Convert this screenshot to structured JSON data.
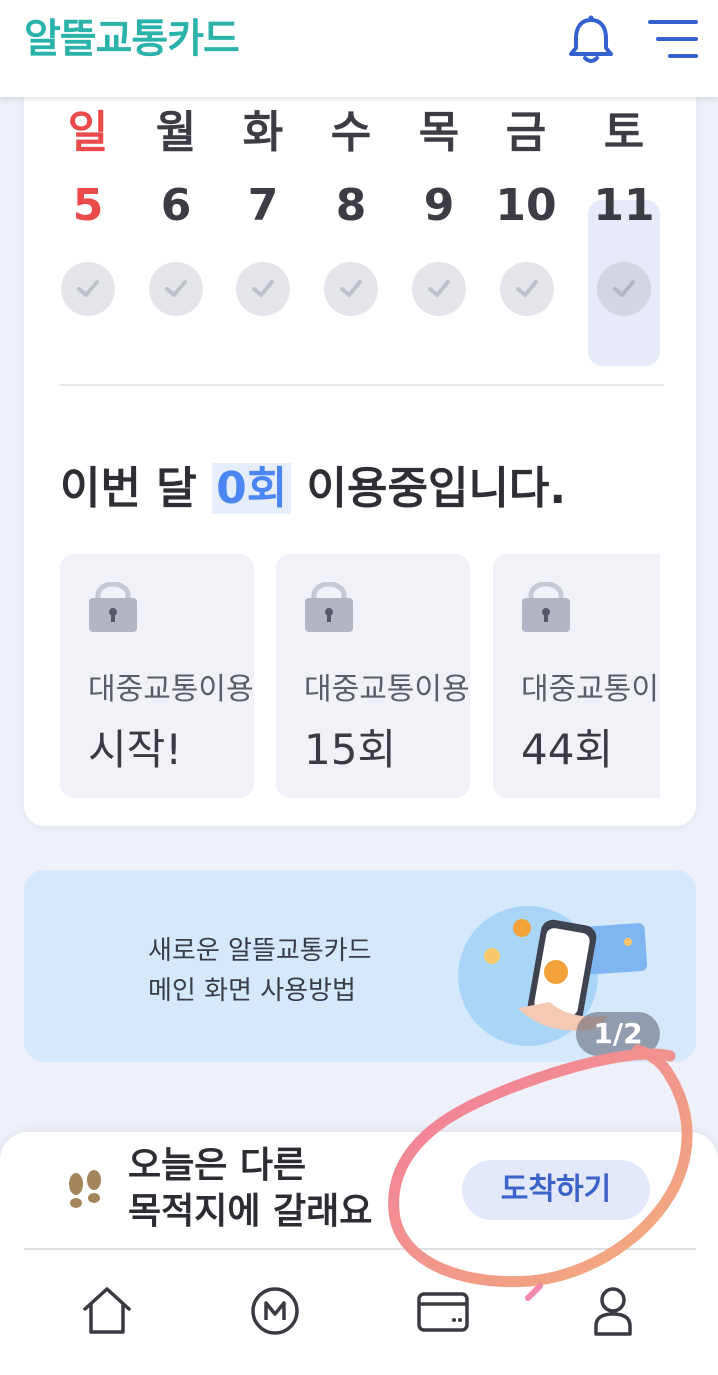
{
  "header": {
    "logo": "알뜰교통카드",
    "bell_icon": "bell-icon",
    "menu_icon": "hamburger-menu-icon"
  },
  "week": {
    "days": [
      {
        "dow": "일",
        "date": "5",
        "sunday": true
      },
      {
        "dow": "월",
        "date": "6"
      },
      {
        "dow": "화",
        "date": "7"
      },
      {
        "dow": "수",
        "date": "8"
      },
      {
        "dow": "목",
        "date": "9"
      },
      {
        "dow": "금",
        "date": "10"
      },
      {
        "dow": "토",
        "date": "11",
        "selected": true
      }
    ]
  },
  "usage": {
    "prefix": "이번 달",
    "count": "0회",
    "suffix": "이용중입니다."
  },
  "badges": [
    {
      "title": "대중교통이용",
      "value": "시작!"
    },
    {
      "title": "대중교통이용",
      "value": "15회"
    },
    {
      "title": "대중교통이용",
      "value": "44회"
    }
  ],
  "banner": {
    "line1": "새로운 알뜰교통카드",
    "line2": "메인 화면 사용방법",
    "pager": "1/2"
  },
  "sheet": {
    "line1": "오늘은 다른",
    "line2": "목적지에 갈래요",
    "arrive_button": "도착하기"
  },
  "bottom_nav": [
    "home-icon",
    "mileage-icon",
    "card-icon",
    "profile-icon"
  ],
  "colors": {
    "brand": "#2bb3ab",
    "accent": "#4b86f4",
    "sunday": "#ea4a4a",
    "annotation": "#f06a9a"
  }
}
